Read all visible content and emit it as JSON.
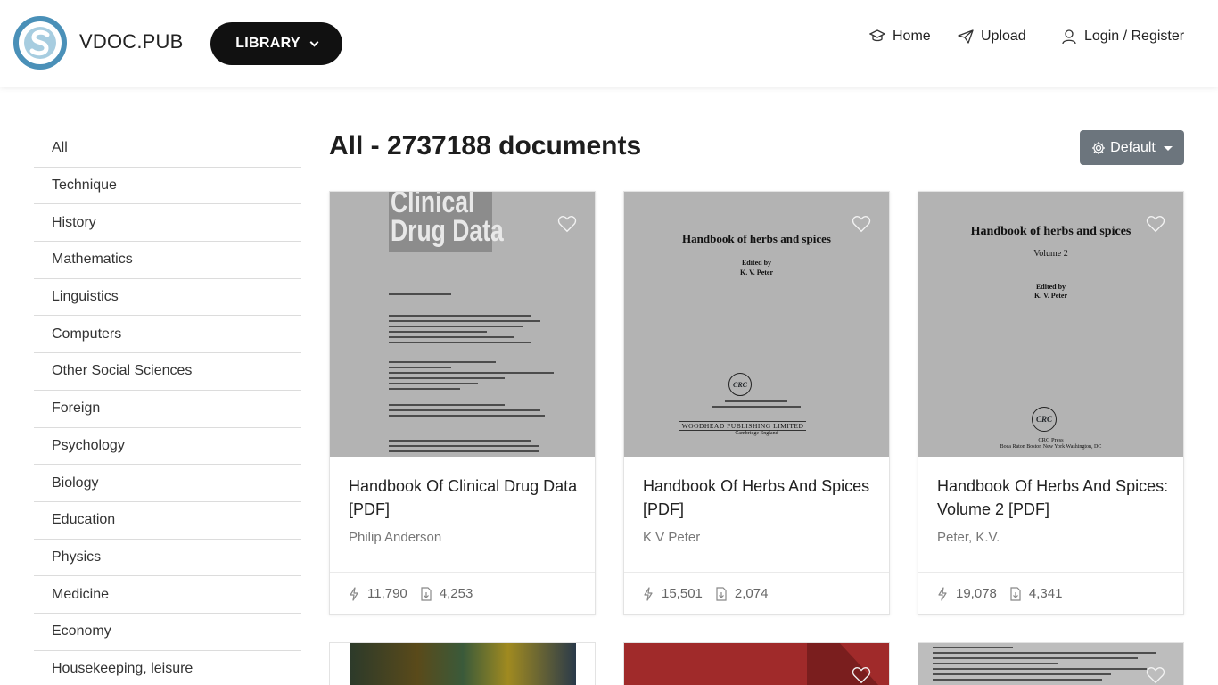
{
  "header": {
    "brand": "VDOC.PUB",
    "library_label": "LIBRARY",
    "nav": {
      "home": "Home",
      "upload": "Upload",
      "login": "Login / Register"
    }
  },
  "sidebar": {
    "categories": [
      "All",
      "Technique",
      "History",
      "Mathematics",
      "Linguistics",
      "Computers",
      "Other Social Sciences",
      "Foreign",
      "Psychology",
      "Biology",
      "Education",
      "Physics",
      "Medicine",
      "Economy",
      "Housekeeping, leisure"
    ]
  },
  "main": {
    "title": "All - 2737188 documents",
    "sort_label": "Default",
    "cards": [
      {
        "title": "Handbook Of Clinical Drug Data [PDF]",
        "author": "Philip Anderson",
        "views": "11,790",
        "downloads": "4,253",
        "cover": {
          "big_title_line1": "Clinical",
          "big_title_line2": "Drug Data"
        }
      },
      {
        "title": "Handbook Of Herbs And Spices [PDF]",
        "author": "K V Peter",
        "views": "15,501",
        "downloads": "2,074",
        "cover": {
          "heading": "Handbook of herbs and spices",
          "edited": "Edited by",
          "editor": "K. V. Peter",
          "publisher_logo": "CRC",
          "publisher": "WOODHEAD PUBLISHING LIMITED",
          "place": "Cambridge England"
        }
      },
      {
        "title": "Handbook Of Herbs And Spices: Volume 2 [PDF]",
        "author": "Peter, K.V.",
        "views": "19,078",
        "downloads": "4,341",
        "cover": {
          "heading": "Handbook of herbs and spices",
          "volume": "Volume 2",
          "edited": "Edited by",
          "editor": "K. V. Peter",
          "publisher_logo": "CRC",
          "publisher": "CRC Press",
          "place": "Boca Raton  Boston  New York  Washington, DC"
        }
      }
    ]
  },
  "icons": {
    "logo": "vdoc-logo-icon",
    "home": "graduation-cap-icon",
    "upload": "paper-plane-icon",
    "login": "user-icon",
    "heart": "heart-icon",
    "views": "bolt-icon",
    "downloads": "file-download-icon",
    "sort": "gear-icon"
  },
  "colors": {
    "accent_dark": "#111111",
    "sort_button": "#6c757d",
    "logo_blue": "#4a90b8"
  }
}
